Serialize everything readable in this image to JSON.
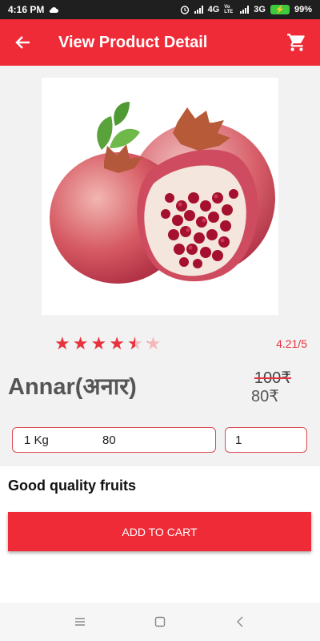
{
  "status_bar": {
    "time": "4:16 PM",
    "network_1": "4G",
    "network_1_sub": "Vo LTE",
    "network_2": "3G",
    "battery": "99%"
  },
  "app_bar": {
    "title": "View Product Detail",
    "back_icon": "arrow-left-icon",
    "cart_icon": "shopping-cart-icon"
  },
  "product": {
    "name": "Annar(अनार)",
    "rating": 4.21,
    "rating_text": "4.21/5",
    "stars_total": 5,
    "price_old": "100₹",
    "price_new": "80₹",
    "variant": {
      "unit": "1 Kg",
      "price": "80"
    },
    "quantity": "1",
    "description": "Good quality fruits"
  },
  "actions": {
    "add_to_cart": "ADD TO CART"
  },
  "nav": {
    "menu_icon": "menu-icon",
    "home_icon": "home-square-icon",
    "back_icon": "back-chevron-icon"
  },
  "colors": {
    "primary": "#ef2b37",
    "status_bar": "#1f1f1f",
    "star": "#e8323e"
  }
}
